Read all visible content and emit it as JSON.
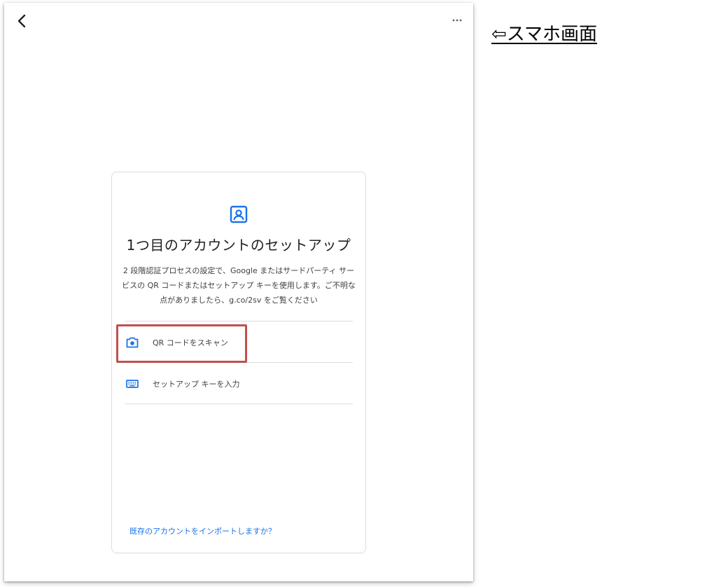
{
  "card": {
    "title": "1つ目のアカウントのセットアップ",
    "description": "2 段階認証プロセスの設定で、Google またはサードパーティ サービスの QR コードまたはセットアップ キーを使用します。ご不明な点がありましたら、g.co/2sv をご覧ください",
    "options": [
      {
        "label": "QR コードをスキャン",
        "icon": "camera-icon"
      },
      {
        "label": "セットアップ キーを入力",
        "icon": "keyboard-icon"
      }
    ],
    "import_link": "既存のアカウントをインポートしますか？"
  },
  "annotation": {
    "text": "⇦スマホ画面"
  },
  "colors": {
    "accent": "#1a73e8",
    "highlight": "#c0504d",
    "text": "#202124"
  }
}
